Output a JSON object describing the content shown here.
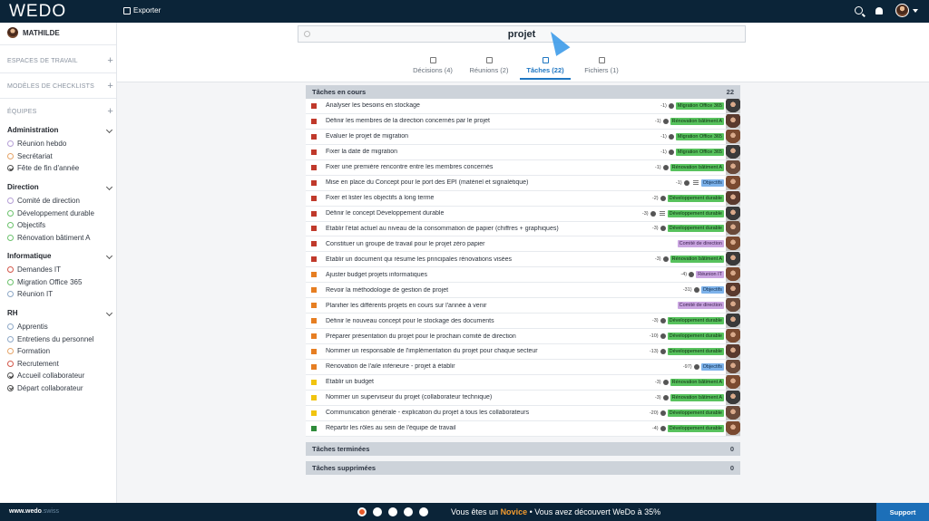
{
  "app": {
    "logo": "WEDO",
    "export_label": "Exporter"
  },
  "user": {
    "name": "MATHILDE"
  },
  "sidebar": {
    "sections": [
      {
        "label": "ESPACES DE TRAVAIL",
        "plus": "+"
      },
      {
        "label": "MODÈLES DE CHECKLISTS",
        "plus": "+"
      },
      {
        "label": "ÉQUIPES",
        "plus": "+"
      }
    ],
    "groups": [
      {
        "title": "Administration",
        "items": [
          {
            "label": "Réunion hebdo",
            "color": "#b59fd6",
            "check": false
          },
          {
            "label": "Secrétariat",
            "color": "#e6a56a",
            "check": false
          },
          {
            "label": "Fête de fin d'année",
            "color": "#555555",
            "check": true
          }
        ]
      },
      {
        "title": "Direction",
        "items": [
          {
            "label": "Comité de direction",
            "color": "#b59fd6",
            "check": false
          },
          {
            "label": "Développement durable",
            "color": "#6cc26d",
            "check": false
          },
          {
            "label": "Objectifs",
            "color": "#6cc26d",
            "check": false
          },
          {
            "label": "Rénovation bâtiment A",
            "color": "#6cc26d",
            "check": false
          }
        ]
      },
      {
        "title": "Informatique",
        "items": [
          {
            "label": "Demandes IT",
            "color": "#d2574a",
            "check": false
          },
          {
            "label": "Migration Office 365",
            "color": "#6cc26d",
            "check": false
          },
          {
            "label": "Réunion IT",
            "color": "#8fa9c8",
            "check": false
          }
        ]
      },
      {
        "title": "RH",
        "items": [
          {
            "label": "Apprentis",
            "color": "#8fa9c8",
            "check": false
          },
          {
            "label": "Entretiens du personnel",
            "color": "#8fa9c8",
            "check": false
          },
          {
            "label": "Formation",
            "color": "#e6a56a",
            "check": false
          },
          {
            "label": "Recrutement",
            "color": "#d2574a",
            "check": false
          },
          {
            "label": "Accueil collaborateur",
            "color": "#555555",
            "check": true
          },
          {
            "label": "Départ collaborateur",
            "color": "#555555",
            "check": true
          }
        ]
      }
    ]
  },
  "search": {
    "query": "projet"
  },
  "tabs": [
    {
      "label": "Décisions (4)",
      "icon": "gavel-icon"
    },
    {
      "label": "Réunions (2)",
      "icon": "calendar-icon"
    },
    {
      "label": "Tâches (22)",
      "icon": "checkbox-icon",
      "active": true
    },
    {
      "label": "Fichiers (1)",
      "icon": "file-icon"
    }
  ],
  "sections": {
    "current": {
      "label": "Tâches en cours",
      "count": "22"
    },
    "done": {
      "label": "Tâches terminées",
      "count": "0"
    },
    "deleted": {
      "label": "Tâches supprimées",
      "count": "0"
    }
  },
  "tasks": [
    {
      "title": "Analyser les besoins en stockage",
      "num": "-1)",
      "tag": "Migration Office 365",
      "tagType": "g",
      "priority": "#c0392b",
      "avatar": "#3a3a3a"
    },
    {
      "title": "Définir les membres de la direction concernés par le projet",
      "num": "-1)",
      "tag": "Rénovation bâtiment A",
      "tagType": "g",
      "priority": "#c0392b",
      "avatar": "#5a3a2e"
    },
    {
      "title": "Évaluer le projet de migration",
      "num": "-1)",
      "tag": "Migration Office 365",
      "tagType": "g",
      "priority": "#c0392b",
      "avatar": "#7a4a30"
    },
    {
      "title": "Fixer la date de migration",
      "num": "-1)",
      "tag": "Migration Office 365",
      "tagType": "g",
      "priority": "#c0392b",
      "avatar": "#3a3a3a"
    },
    {
      "title": "Fixer une première rencontre entre les membres concernés",
      "num": "-1)",
      "tag": "Rénovation bâtiment A",
      "tagType": "g",
      "priority": "#c0392b",
      "avatar": "#6a4a3a"
    },
    {
      "title": "Mise en place du Concept pour le port des EPI (matériel et signalétique)",
      "num": "-1)",
      "tag": "Objectifs",
      "tagType": "b",
      "priority": "#c0392b",
      "avatar": "#7a4a30",
      "lines": true
    },
    {
      "title": "Fixer et lister les objectifs à long terme",
      "num": "-2)",
      "tag": "Développement durable",
      "tagType": "g",
      "priority": "#c0392b",
      "avatar": "#5a3a2e"
    },
    {
      "title": "Définir le concept Développement durable",
      "num": "-3)",
      "tag": "Développement durable",
      "tagType": "g",
      "priority": "#c0392b",
      "avatar": "#3a3a3a",
      "lines": true
    },
    {
      "title": "Établir l'état actuel au niveau de la consommation de papier (chiffres + graphiques)",
      "num": "-3)",
      "tag": "Développement durable",
      "tagType": "g",
      "priority": "#c0392b",
      "avatar": "#6a4a3a"
    },
    {
      "title": "Constituer un groupe de travail pour le projet zéro papier",
      "num": "",
      "tag": "Comité de direction",
      "tagType": "p",
      "priority": "#c0392b",
      "avatar": "#7a4a30"
    },
    {
      "title": "Établir un document qui résume les principales rénovations visées",
      "num": "-3)",
      "tag": "Rénovation bâtiment A",
      "tagType": "g",
      "priority": "#c0392b",
      "avatar": "#3a3a3a"
    },
    {
      "title": "Ajuster budget projets informatiques",
      "num": "-4)",
      "tag": "Réunion IT",
      "tagType": "p",
      "priority": "#e67e22",
      "avatar": "#7a4a30"
    },
    {
      "title": "Revoir la méthodologie de gestion de projet",
      "num": "-31)",
      "tag": "Objectifs",
      "tagType": "b",
      "priority": "#e67e22",
      "avatar": "#5a3a2e"
    },
    {
      "title": "Planifier les différents projets en cours sur l'année à venir",
      "num": "",
      "tag": "Comité de direction",
      "tagType": "p",
      "priority": "#e67e22",
      "avatar": "#6a4a3a"
    },
    {
      "title": "Définir le nouveau concept pour le stockage des documents",
      "num": "-3)",
      "tag": "Développement durable",
      "tagType": "g",
      "priority": "#e67e22",
      "avatar": "#3a3a3a"
    },
    {
      "title": "Préparer présentation du projet pour le prochain comité de direction",
      "num": "-10)",
      "tag": "Développement durable",
      "tagType": "g",
      "priority": "#e67e22",
      "avatar": "#7a4a30"
    },
    {
      "title": "Nommer un responsable de l'implémentation du projet pour chaque secteur",
      "num": "-13)",
      "tag": "Développement durable",
      "tagType": "g",
      "priority": "#e67e22",
      "avatar": "#5a3a2e"
    },
    {
      "title": "Rénovation de l'aile inférieure - projet à établir",
      "num": "-97)",
      "tag": "Objectifs",
      "tagType": "b",
      "priority": "#e67e22",
      "avatar": "#6a4a3a"
    },
    {
      "title": "Établir un budget",
      "num": "-3)",
      "tag": "Rénovation bâtiment A",
      "tagType": "g",
      "priority": "#f1c40f",
      "avatar": "#7a4a30"
    },
    {
      "title": "Nommer un superviseur du projet (collaborateur technique)",
      "num": "-3)",
      "tag": "Rénovation bâtiment A",
      "tagType": "g",
      "priority": "#f1c40f",
      "avatar": "#3a3a3a"
    },
    {
      "title": "Communication générale - explication du projet à tous les collaborateurs",
      "num": "-20)",
      "tag": "Développement durable",
      "tagType": "g",
      "priority": "#f1c40f",
      "avatar": "#6a4a3a"
    },
    {
      "title": "Répartir les rôles au sein de l'équipe de travail",
      "num": "-4)",
      "tag": "Développement durable",
      "tagType": "g",
      "priority": "#2e8b3a",
      "avatar": "#7a4a30"
    }
  ],
  "bottom": {
    "site": "www.wedo",
    "site_suffix": ".swiss",
    "progress_prefix": "Vous êtes un",
    "level": "Novice",
    "progress_suffix": "• Vous avez découvert WeDo à 35%",
    "support": "Support",
    "step_icon": "1"
  }
}
